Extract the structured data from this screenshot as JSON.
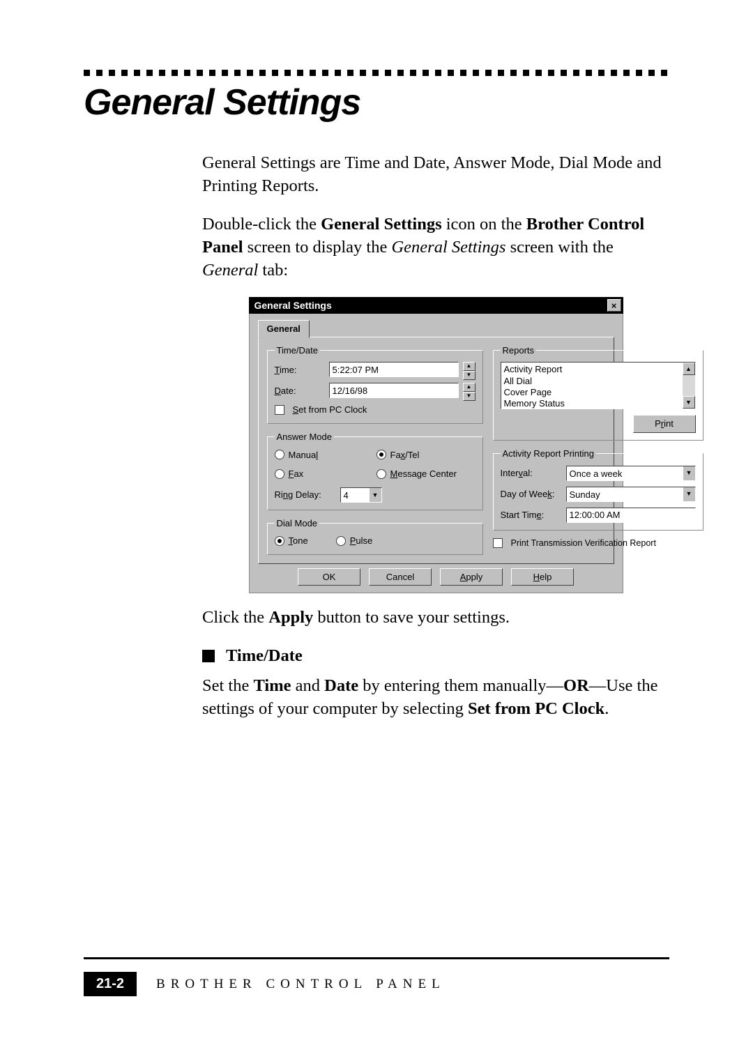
{
  "heading": "General Settings",
  "intro1": "General Settings are Time and Date, Answer Mode, Dial Mode and Printing Reports.",
  "intro2_a": "Double-click the ",
  "intro2_b": "General Settings",
  "intro2_c": " icon on the ",
  "intro2_d": "Brother Control Panel",
  "intro2_e": " screen to display the ",
  "intro2_f": "General Settings",
  "intro2_g": " screen with the ",
  "intro2_h": "General",
  "intro2_i": " tab:",
  "dialog": {
    "title": "General Settings",
    "tab": "General",
    "time_date": {
      "legend": "Time/Date",
      "time_label": "Time:",
      "time_value": "5:22:07 PM",
      "date_label": "Date:",
      "date_value": "12/16/98",
      "set_pc": "Set from PC Clock"
    },
    "answer_mode": {
      "legend": "Answer Mode",
      "manual": "Manual",
      "faxtel": "Fax/Tel",
      "fax": "Fax",
      "msgcenter": "Message Center",
      "ring_delay_label": "Ring Delay:",
      "ring_delay_value": "4"
    },
    "dial_mode": {
      "legend": "Dial Mode",
      "tone": "Tone",
      "pulse": "Pulse"
    },
    "reports": {
      "legend": "Reports",
      "items": [
        "Activity Report",
        "All Dial",
        "Cover Page",
        "Memory Status"
      ],
      "print_btn": "Print"
    },
    "arp": {
      "legend": "Activity Report Printing",
      "interval_label": "Interval:",
      "interval_value": "Once a week",
      "dow_label": "Day of Week:",
      "dow_value": "Sunday",
      "start_label": "Start Time:",
      "start_value": "12:00:00 AM"
    },
    "ptvr": "Print Transmission Verification Report",
    "buttons": {
      "ok": "OK",
      "cancel": "Cancel",
      "apply": "Apply",
      "help": "Help"
    }
  },
  "apply_line_a": "Click the ",
  "apply_line_b": "Apply",
  "apply_line_c": " button to save your settings.",
  "bullet_title": "Time/Date",
  "sub_a": "Set the ",
  "sub_b": "Time",
  "sub_c": " and ",
  "sub_d": "Date",
  "sub_e": " by entering them manually—",
  "sub_f": "OR",
  "sub_g": "—Use the settings of your computer by selecting ",
  "sub_h": "Set from PC Clock",
  "sub_i": ".",
  "footer": {
    "page": "21-2",
    "text": "BROTHER CONTROL PANEL"
  }
}
